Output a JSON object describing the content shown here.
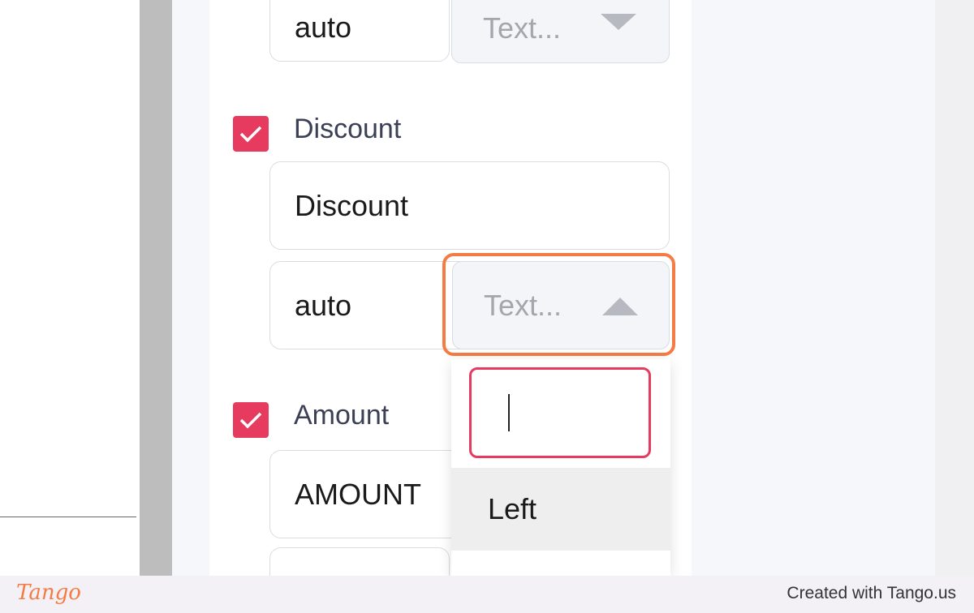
{
  "colors": {
    "accent": "#e63a5f",
    "highlight": "#f47c44",
    "border": "#d9dce3"
  },
  "top_row": {
    "width_value": "auto",
    "align_select": "Text..."
  },
  "discount": {
    "checked": true,
    "label": "Discount",
    "title_value": "Discount",
    "width_value": "auto",
    "align_select": "Text..."
  },
  "amount": {
    "checked": true,
    "label": "Amount",
    "title_value": "AMOUNT"
  },
  "dropdown": {
    "search_value": "",
    "options": [
      "Left"
    ]
  },
  "icons": {
    "checkbox": "check-icon",
    "select_closed": "triangle-down-icon",
    "select_open": "triangle-up-icon"
  },
  "footer": {
    "logo": "Tango",
    "credit": "Created with Tango.us"
  }
}
